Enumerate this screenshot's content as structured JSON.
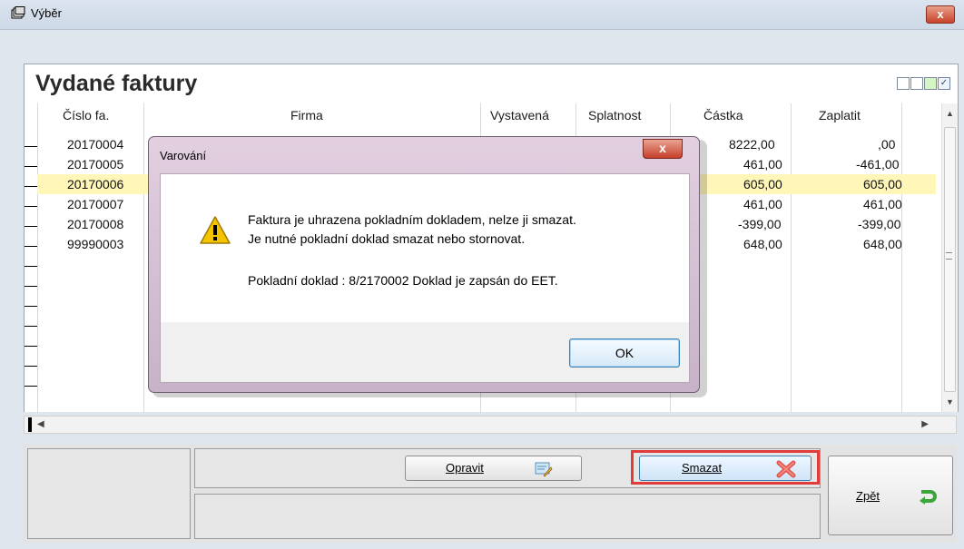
{
  "window": {
    "title": "Výběr",
    "close": "x"
  },
  "page_title": "Vydané faktury",
  "columns": {
    "cislo": "Číslo fa.",
    "firma": "Firma",
    "vystavena": "Vystavená",
    "splatnost": "Splatnost",
    "castka": "Částka",
    "zaplatit": "Zaplatit"
  },
  "rows": [
    {
      "cislo": "20170004",
      "castka": "8222,00",
      "zaplatit": ",00"
    },
    {
      "cislo": "20170005",
      "castka": "461,00",
      "zaplatit": "-461,00"
    },
    {
      "cislo": "20170006",
      "castka": "605,00",
      "zaplatit": "605,00"
    },
    {
      "cislo": "20170007",
      "castka": "461,00",
      "zaplatit": "461,00"
    },
    {
      "cislo": "20170008",
      "castka": "-399,00",
      "zaplatit": "-399,00"
    },
    {
      "cislo": "99990003",
      "castka": "648,00",
      "zaplatit": "648,00"
    }
  ],
  "selected_row": 2,
  "buttons": {
    "opravit": "Opravit",
    "smazat": "Smazat",
    "zpet": "Zpět"
  },
  "dialog": {
    "title": "Varování",
    "close": "x",
    "line1": "Faktura je uhrazena pokladním dokladem, nelze ji smazat.",
    "line2": "Je nutné pokladní doklad smazat nebo stornovat.",
    "line3": "Pokladní doklad : 8/2170002 Doklad je zapsán do EET.",
    "ok": "OK"
  },
  "icons": {
    "app": "folder-stack-icon",
    "edit": "edit-form-icon",
    "delete": "red-x-icon",
    "back": "green-return-icon",
    "warning": "warning-icon"
  },
  "colors": {
    "selected_row": "#fff6b8",
    "highlight": "#e03c3c",
    "dialog_frame": "#d7c1d6"
  }
}
